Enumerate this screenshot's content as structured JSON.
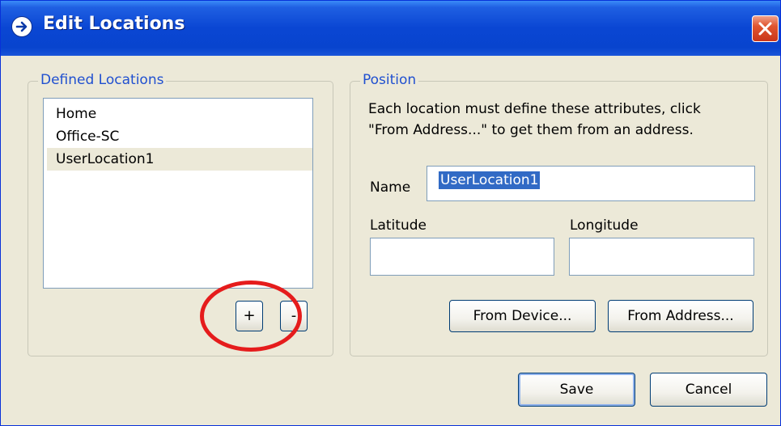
{
  "window": {
    "title": "Edit Locations"
  },
  "defined_locations": {
    "group_label": "Defined Locations",
    "items": [
      "Home",
      "Office-SC",
      "UserLocation1"
    ],
    "selected_index": 2,
    "add_button": "+",
    "remove_button": "-"
  },
  "position": {
    "group_label": "Position",
    "help_line1": "Each location must define these attributes, click",
    "help_line2": "\"From Address...\" to get them from an address.",
    "name_label": "Name",
    "name_value": "UserLocation1",
    "latitude_label": "Latitude",
    "latitude_value": "",
    "longitude_label": "Longitude",
    "longitude_value": "",
    "from_device_button": "From Device...",
    "from_address_button": "From Address..."
  },
  "footer": {
    "save_button": "Save",
    "cancel_button": "Cancel"
  },
  "annotation": {
    "shape": "circle",
    "color": "#e51c1c",
    "target": "add_button"
  }
}
